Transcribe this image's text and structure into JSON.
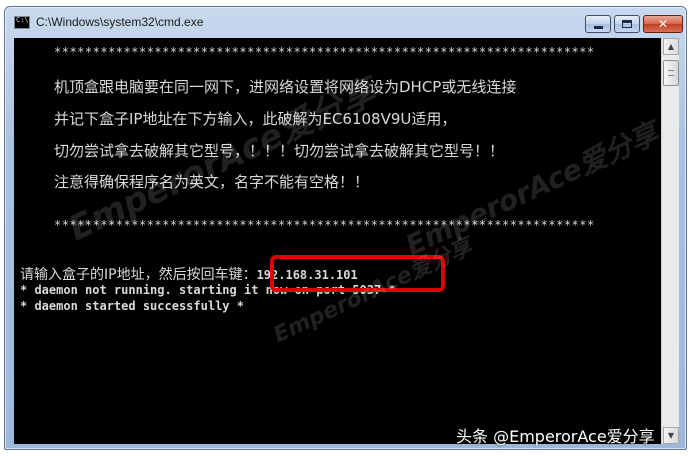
{
  "window": {
    "title": "C:\\Windows\\system32\\cmd.exe"
  },
  "console": {
    "stars_top": "**********************************************************************",
    "lines": [
      "机顶盒跟电脑要在同一网下，进网络设置将网络设为DHCP或无线连接",
      "并记下盒子IP地址在下方输入，此破解为EC6108V9U适用，",
      "切勿尝试拿去破解其它型号，！！！切勿尝试拿去破解其它型号！！",
      "注意得确保程序名为英文，名字不能有空格！！"
    ],
    "stars_bottom": "**********************************************************************",
    "prompt": "请输入盒子的IP地址，然后按回车键：",
    "ip": "192.168.31.101",
    "daemon_1": "* daemon not running. starting it now on port 5037 *",
    "daemon_2": "* daemon started successfully *"
  },
  "watermark": {
    "text": "EmperorAce爱分享"
  },
  "credit": {
    "text": "头条 @EmperorAce爱分享"
  }
}
